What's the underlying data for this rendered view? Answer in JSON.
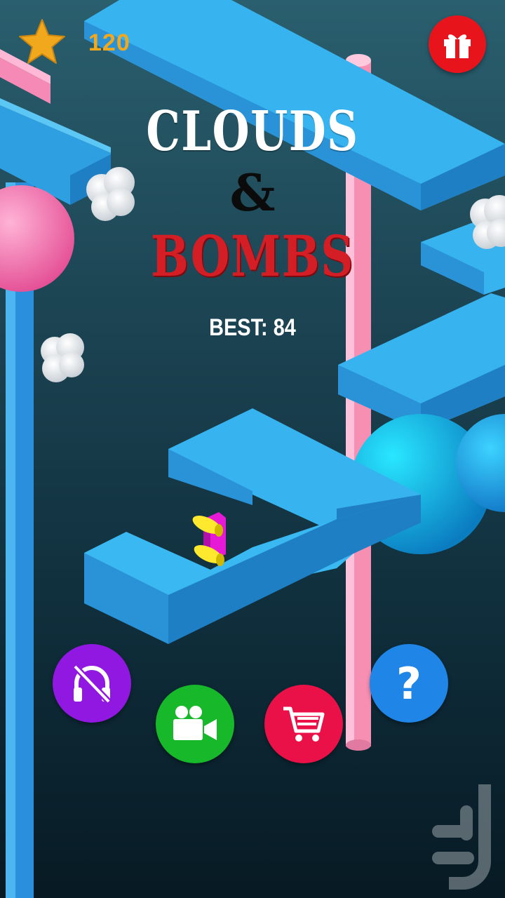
{
  "hud": {
    "star_count": "120",
    "star_icon": "star-icon",
    "gift_icon": "gift-icon"
  },
  "title": {
    "line1": "CLOUDS",
    "line2": "&",
    "line3": "BOMBS"
  },
  "best_score": "BEST: 84",
  "buttons": {
    "audio_icon": "headphones-muted-icon",
    "video_icon": "video-camera-icon",
    "shop_icon": "shopping-cart-icon",
    "help_icon": "question-icon",
    "help_label": "?"
  },
  "colors": {
    "platform": "#37b4f0",
    "pillar_pink": "#f78fb3",
    "score": "#f2a81d",
    "bombs_title": "#d41e26",
    "gift_button": "#e8141c",
    "audio_button": "#9018e0",
    "video_button": "#17b92a",
    "shop_button": "#ea1148",
    "help_button": "#1f86e8"
  }
}
